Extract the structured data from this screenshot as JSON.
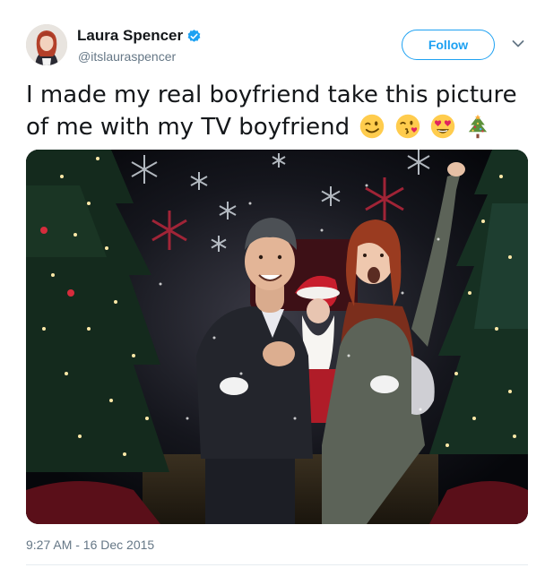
{
  "author": {
    "display_name": "Laura Spencer",
    "handle": "@itslauraspencer",
    "verified": true
  },
  "actions": {
    "follow_label": "Follow",
    "more_icon": "chevron-down-icon"
  },
  "tweet": {
    "text": "I made my real boyfriend take this picture of me with my TV boyfriend",
    "emojis": [
      "winking-face",
      "face-blowing-kiss",
      "heart-eyes-face",
      "christmas-tree"
    ],
    "timestamp": "9:27 AM - 16 Dec 2015"
  },
  "colors": {
    "accent": "#1da1f2",
    "secondary_text": "#657786",
    "primary_text": "#14171a"
  }
}
